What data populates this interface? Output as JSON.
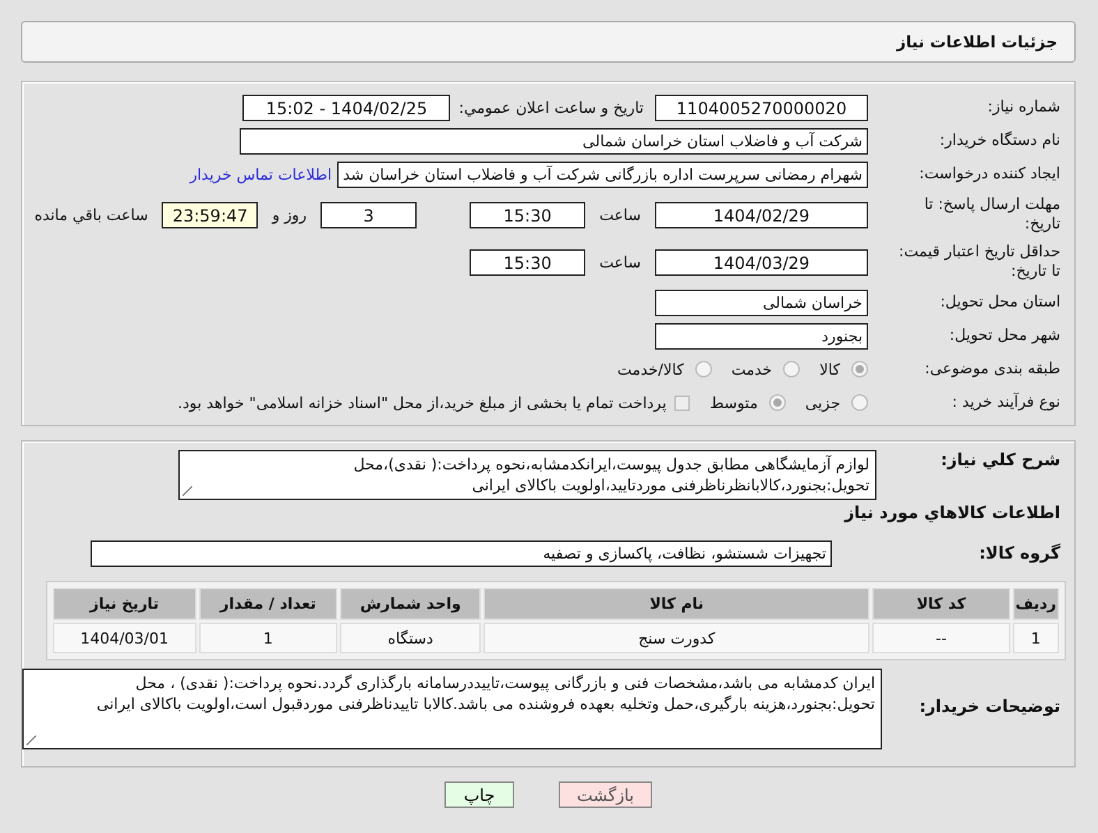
{
  "header": {
    "title": "جزئیات اطلاعات نیاز"
  },
  "need_number": {
    "label": "شماره نیاز:",
    "value": "1104005270000020"
  },
  "announce": {
    "label": "تاریخ و ساعت اعلان عمومي:",
    "value": "1404/02/25 - 15:02"
  },
  "buyer": {
    "label": "نام دستگاه خریدار:",
    "value": "شرکت آب و فاضلاب استان خراسان شمالی"
  },
  "creator": {
    "label": "ایجاد کننده درخواست:",
    "value": "شهرام رمضانی سرپرست اداره بازرگانی  شرکت آب و فاضلاب استان خراسان شد",
    "link": "اطلاعات تماس خریدار"
  },
  "deadline": {
    "label": "مهلت ارسال پاسخ: تا تاریخ:",
    "date": "1404/02/29",
    "time_label": "ساعت",
    "time": "15:30",
    "days": "3",
    "days_label": "روز و",
    "remaining": "23:59:47",
    "remaining_label": "ساعت باقي مانده"
  },
  "price_validity": {
    "label": "حداقل تاریخ اعتبار قیمت: تا تاریخ:",
    "date": "1404/03/29",
    "time_label": "ساعت",
    "time": "15:30"
  },
  "province": {
    "label": "استان محل تحویل:",
    "value": "خراسان شمالی"
  },
  "city": {
    "label": "شهر محل تحویل:",
    "value": "بجنورد"
  },
  "category": {
    "label": "طبقه بندی موضوعی:",
    "options": [
      {
        "label": "کالا",
        "selected": true
      },
      {
        "label": "خدمت",
        "selected": false
      },
      {
        "label": "کالا/خدمت",
        "selected": false
      }
    ]
  },
  "process": {
    "label": "نوع فرآیند خرید :",
    "options": [
      {
        "label": "جزیی",
        "selected": false
      },
      {
        "label": "متوسط",
        "selected": true
      }
    ],
    "treasury": {
      "label": "پرداخت تمام یا بخشی از مبلغ خرید،از محل \"اسناد خزانه اسلامی\" خواهد بود.",
      "checked": false,
      "disabled": true
    }
  },
  "description": {
    "label": "شرح کلي نیاز:",
    "value": "لوازم آزمایشگاهی مطابق جدول پیوست،ایرانکدمشابه،نحوه پرداخت:( نقدی)،محل تحویل:بجنورد،کالابانظرناظرفنی موردتایید،اولویت باکالای ایرانی"
  },
  "goods_heading": "اطلاعات کالاهاي مورد نیاز",
  "goods_group": {
    "label": "گروه کالا:",
    "value": "تجهیزات شستشو، نظافت، پاکسازی و تصفیه"
  },
  "table": {
    "columns": [
      "ردیف",
      "کد کالا",
      "نام کالا",
      "واحد شمارش",
      "تعداد / مقدار",
      "تاریخ نیاز"
    ],
    "rows": [
      [
        "1",
        "--",
        "کدورت سنج",
        "دستگاه",
        "1",
        "1404/03/01"
      ]
    ]
  },
  "buyer_notes": {
    "label": "توضیحات خریدار:",
    "value": "ایران کدمشابه می باشد،مشخصات فنی و بازرگانی پیوست،تاییددرسامانه بارگذاری گردد.نحوه پرداخت:( نقدی) ، محل تحویل:بجنورد،هزینه بارگیری،حمل وتخلیه بعهده فروشنده می باشد.کالابا تاییدناظرفنی موردقبول است،اولویت باکالای ایرانی"
  },
  "buttons": [
    {
      "label": "بازگشت",
      "kind": "back"
    },
    {
      "label": "چاپ",
      "kind": "print"
    }
  ]
}
